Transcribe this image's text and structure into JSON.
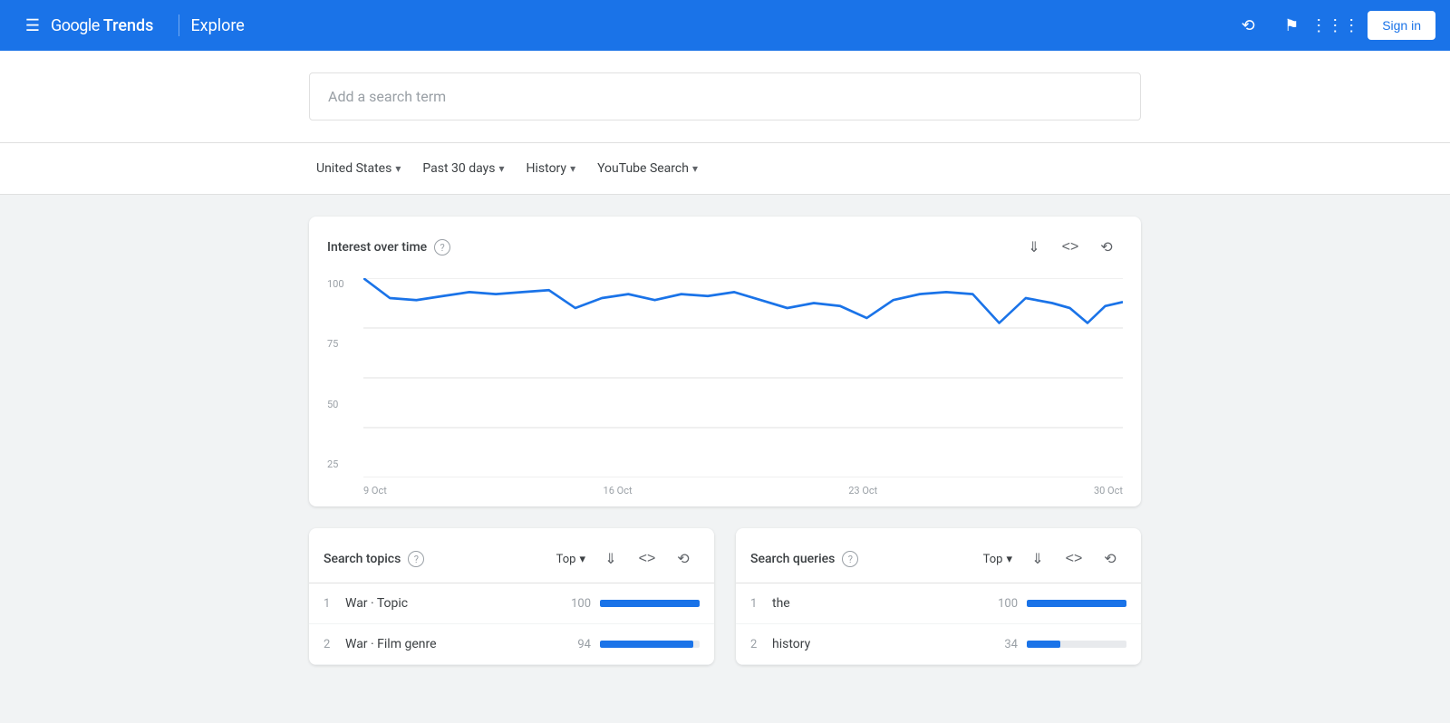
{
  "header": {
    "logo_google": "Google",
    "logo_trends": "Trends",
    "divider": "|",
    "explore_label": "Explore",
    "sign_in_label": "Sign in"
  },
  "search": {
    "placeholder": "Add a search term"
  },
  "filters": {
    "region": "United States",
    "period": "Past 30 days",
    "category": "History",
    "source": "YouTube Search"
  },
  "interest_chart": {
    "title": "Interest over time",
    "y_labels": [
      "100",
      "75",
      "50",
      "25"
    ],
    "x_labels": [
      "9 Oct",
      "16 Oct",
      "23 Oct",
      "30 Oct"
    ]
  },
  "search_topics": {
    "title": "Search topics",
    "top_label": "Top",
    "rows": [
      {
        "num": "1",
        "label": "War · Topic",
        "value": "100",
        "bar_pct": 100
      },
      {
        "num": "2",
        "label": "War · Film genre",
        "value": "94",
        "bar_pct": 94
      }
    ]
  },
  "search_queries": {
    "title": "Search queries",
    "top_label": "Top",
    "rows": [
      {
        "num": "1",
        "label": "the",
        "value": "100",
        "bar_pct": 100
      },
      {
        "num": "2",
        "label": "history",
        "value": "34",
        "bar_pct": 34
      }
    ]
  }
}
